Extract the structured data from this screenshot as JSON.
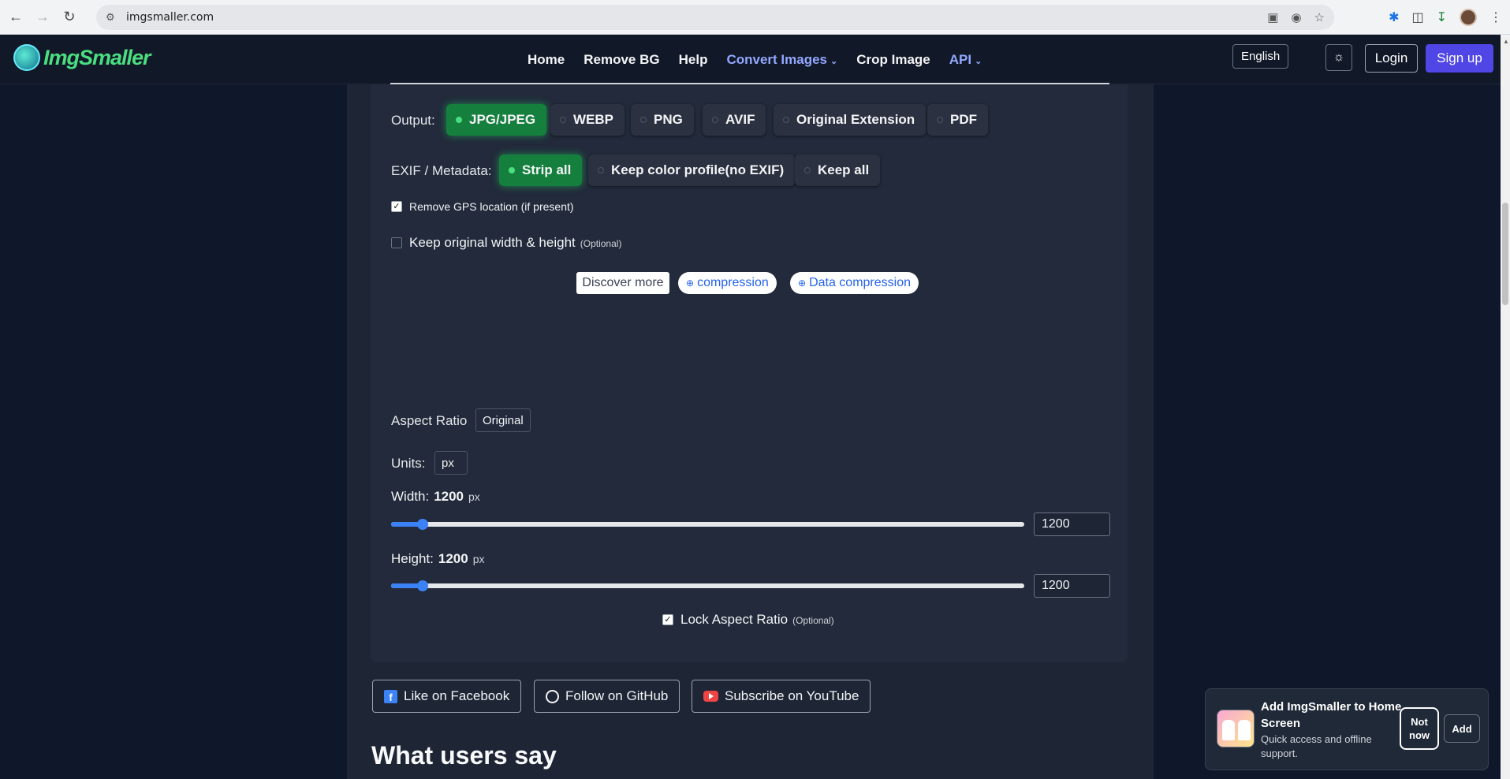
{
  "browser": {
    "url": "imgsmaller.com",
    "icons": [
      "back-icon",
      "forward-icon",
      "reload-icon",
      "site-info-icon",
      "install-app-icon",
      "eye-off-icon",
      "star-icon",
      "extension-puzzle-icon",
      "extensions-icon",
      "download-icon",
      "profile-avatar",
      "kebab-menu-icon"
    ]
  },
  "site": {
    "logo_text": "ImgSmaller",
    "nav": {
      "home": "Home",
      "remove_bg": "Remove BG",
      "help": "Help",
      "convert_images": "Convert Images",
      "crop_image": "Crop Image",
      "api": "API"
    },
    "language": "English",
    "login": "Login",
    "signup": "Sign up"
  },
  "settings": {
    "output_label": "Output:",
    "output_options": [
      {
        "label": "JPG/JPEG",
        "selected": true
      },
      {
        "label": "WEBP",
        "selected": false
      },
      {
        "label": "PNG",
        "selected": false
      },
      {
        "label": "AVIF",
        "selected": false
      },
      {
        "label": "Original Extension",
        "selected": false
      },
      {
        "label": "PDF",
        "selected": false
      }
    ],
    "exif_label": "EXIF / Metadata:",
    "exif_options": [
      {
        "label": "Strip all",
        "selected": true
      },
      {
        "label": "Keep color profile(no EXIF)",
        "selected": false
      },
      {
        "label": "Keep all",
        "selected": false
      }
    ],
    "remove_gps": {
      "label": "Remove GPS location (if present)",
      "checked": true
    },
    "keep_original": {
      "label": "Keep original width & height",
      "optional": "(Optional)",
      "checked": false
    },
    "discover_more": "Discover more",
    "chips": [
      "compression",
      "Data compression"
    ],
    "aspect_ratio_label": "Aspect Ratio",
    "aspect_ratio_value": "Original",
    "units_label": "Units:",
    "units_value": "px",
    "width": {
      "label": "Width:",
      "value": "1200",
      "unit": "px",
      "input": "1200",
      "slider_fraction": 0.05
    },
    "height": {
      "label": "Height:",
      "value": "1200",
      "unit": "px",
      "input": "1200",
      "slider_fraction": 0.05
    },
    "lock_aspect": {
      "label": "Lock Aspect Ratio",
      "optional": "(Optional)",
      "checked": true
    }
  },
  "social": {
    "facebook": "Like on Facebook",
    "github": "Follow on GitHub",
    "youtube": "Subscribe on YouTube"
  },
  "section_heading": "What users say",
  "install_prompt": {
    "title": "Add ImgSmaller to Home Screen",
    "subtitle": "Quick access and offline support.",
    "not_now": "Not now",
    "add": "Add"
  },
  "colors": {
    "page_bg": "#0f172a",
    "panel_bg": "#222a3b",
    "active_green": "#15803d",
    "accent_blue": "#3b82f6",
    "signup": "#4f46e5",
    "nav_accent": "#93a8ff"
  }
}
